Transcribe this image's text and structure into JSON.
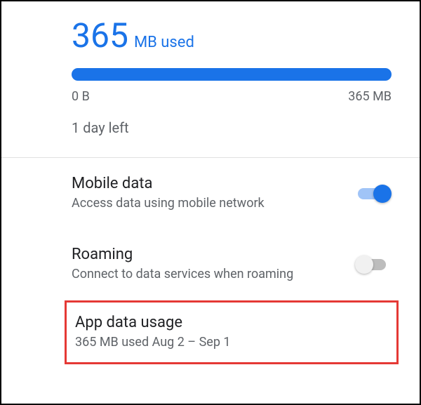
{
  "usage": {
    "value": "365",
    "unit": "MB used",
    "min_label": "0 B",
    "max_label": "365 MB",
    "days_left": "1 day left"
  },
  "settings": {
    "mobile_data": {
      "title": "Mobile data",
      "subtitle": "Access data using mobile network",
      "enabled": true
    },
    "roaming": {
      "title": "Roaming",
      "subtitle": "Connect to data services when roaming",
      "enabled": false
    },
    "app_data_usage": {
      "title": "App data usage",
      "subtitle": "365 MB used Aug 2 – Sep 1"
    }
  }
}
